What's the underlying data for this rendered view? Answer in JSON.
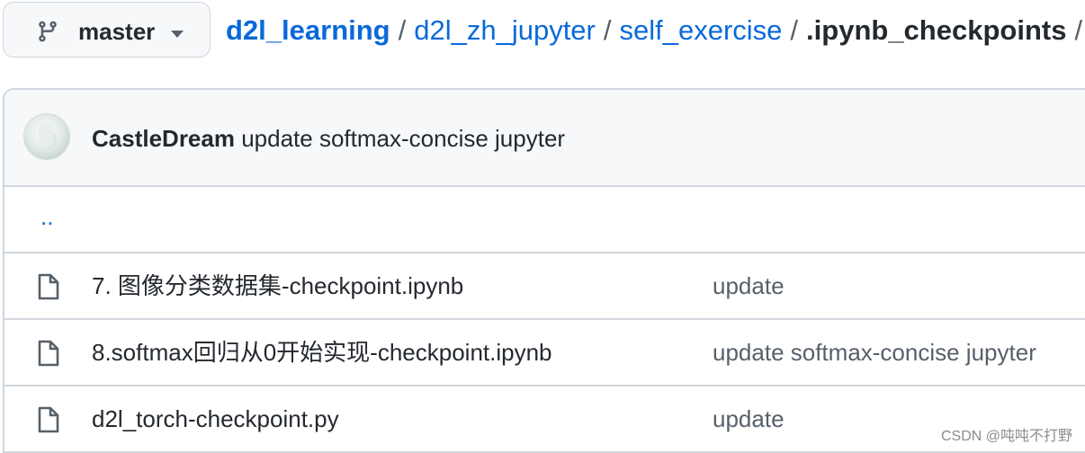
{
  "branch": {
    "label": "master",
    "icon": "git-branch-icon",
    "caret_icon": "caret-down-icon"
  },
  "breadcrumb": {
    "root": "d2l_learning",
    "items": [
      "d2l_zh_jupyter",
      "self_exercise"
    ],
    "current": ".ipynb_checkpoints",
    "separator": "/"
  },
  "commit": {
    "author": "CastleDream",
    "message": "update softmax-concise jupyter"
  },
  "parent_dir": "..",
  "files": [
    {
      "name": "7. 图像分类数据集-checkpoint.ipynb",
      "commit": "update",
      "icon": "file-icon"
    },
    {
      "name": "8.softmax回归从0开始实现-checkpoint.ipynb",
      "commit": "update softmax-concise jupyter",
      "icon": "file-icon"
    },
    {
      "name": "d2l_torch-checkpoint.py",
      "commit": "update",
      "icon": "file-icon"
    }
  ],
  "watermark": "CSDN @吨吨不打野",
  "colors": {
    "link": "#0969da",
    "text": "#24292f",
    "muted": "#57606a",
    "border": "#d0d7de",
    "header_bg": "#f6f8fa"
  }
}
